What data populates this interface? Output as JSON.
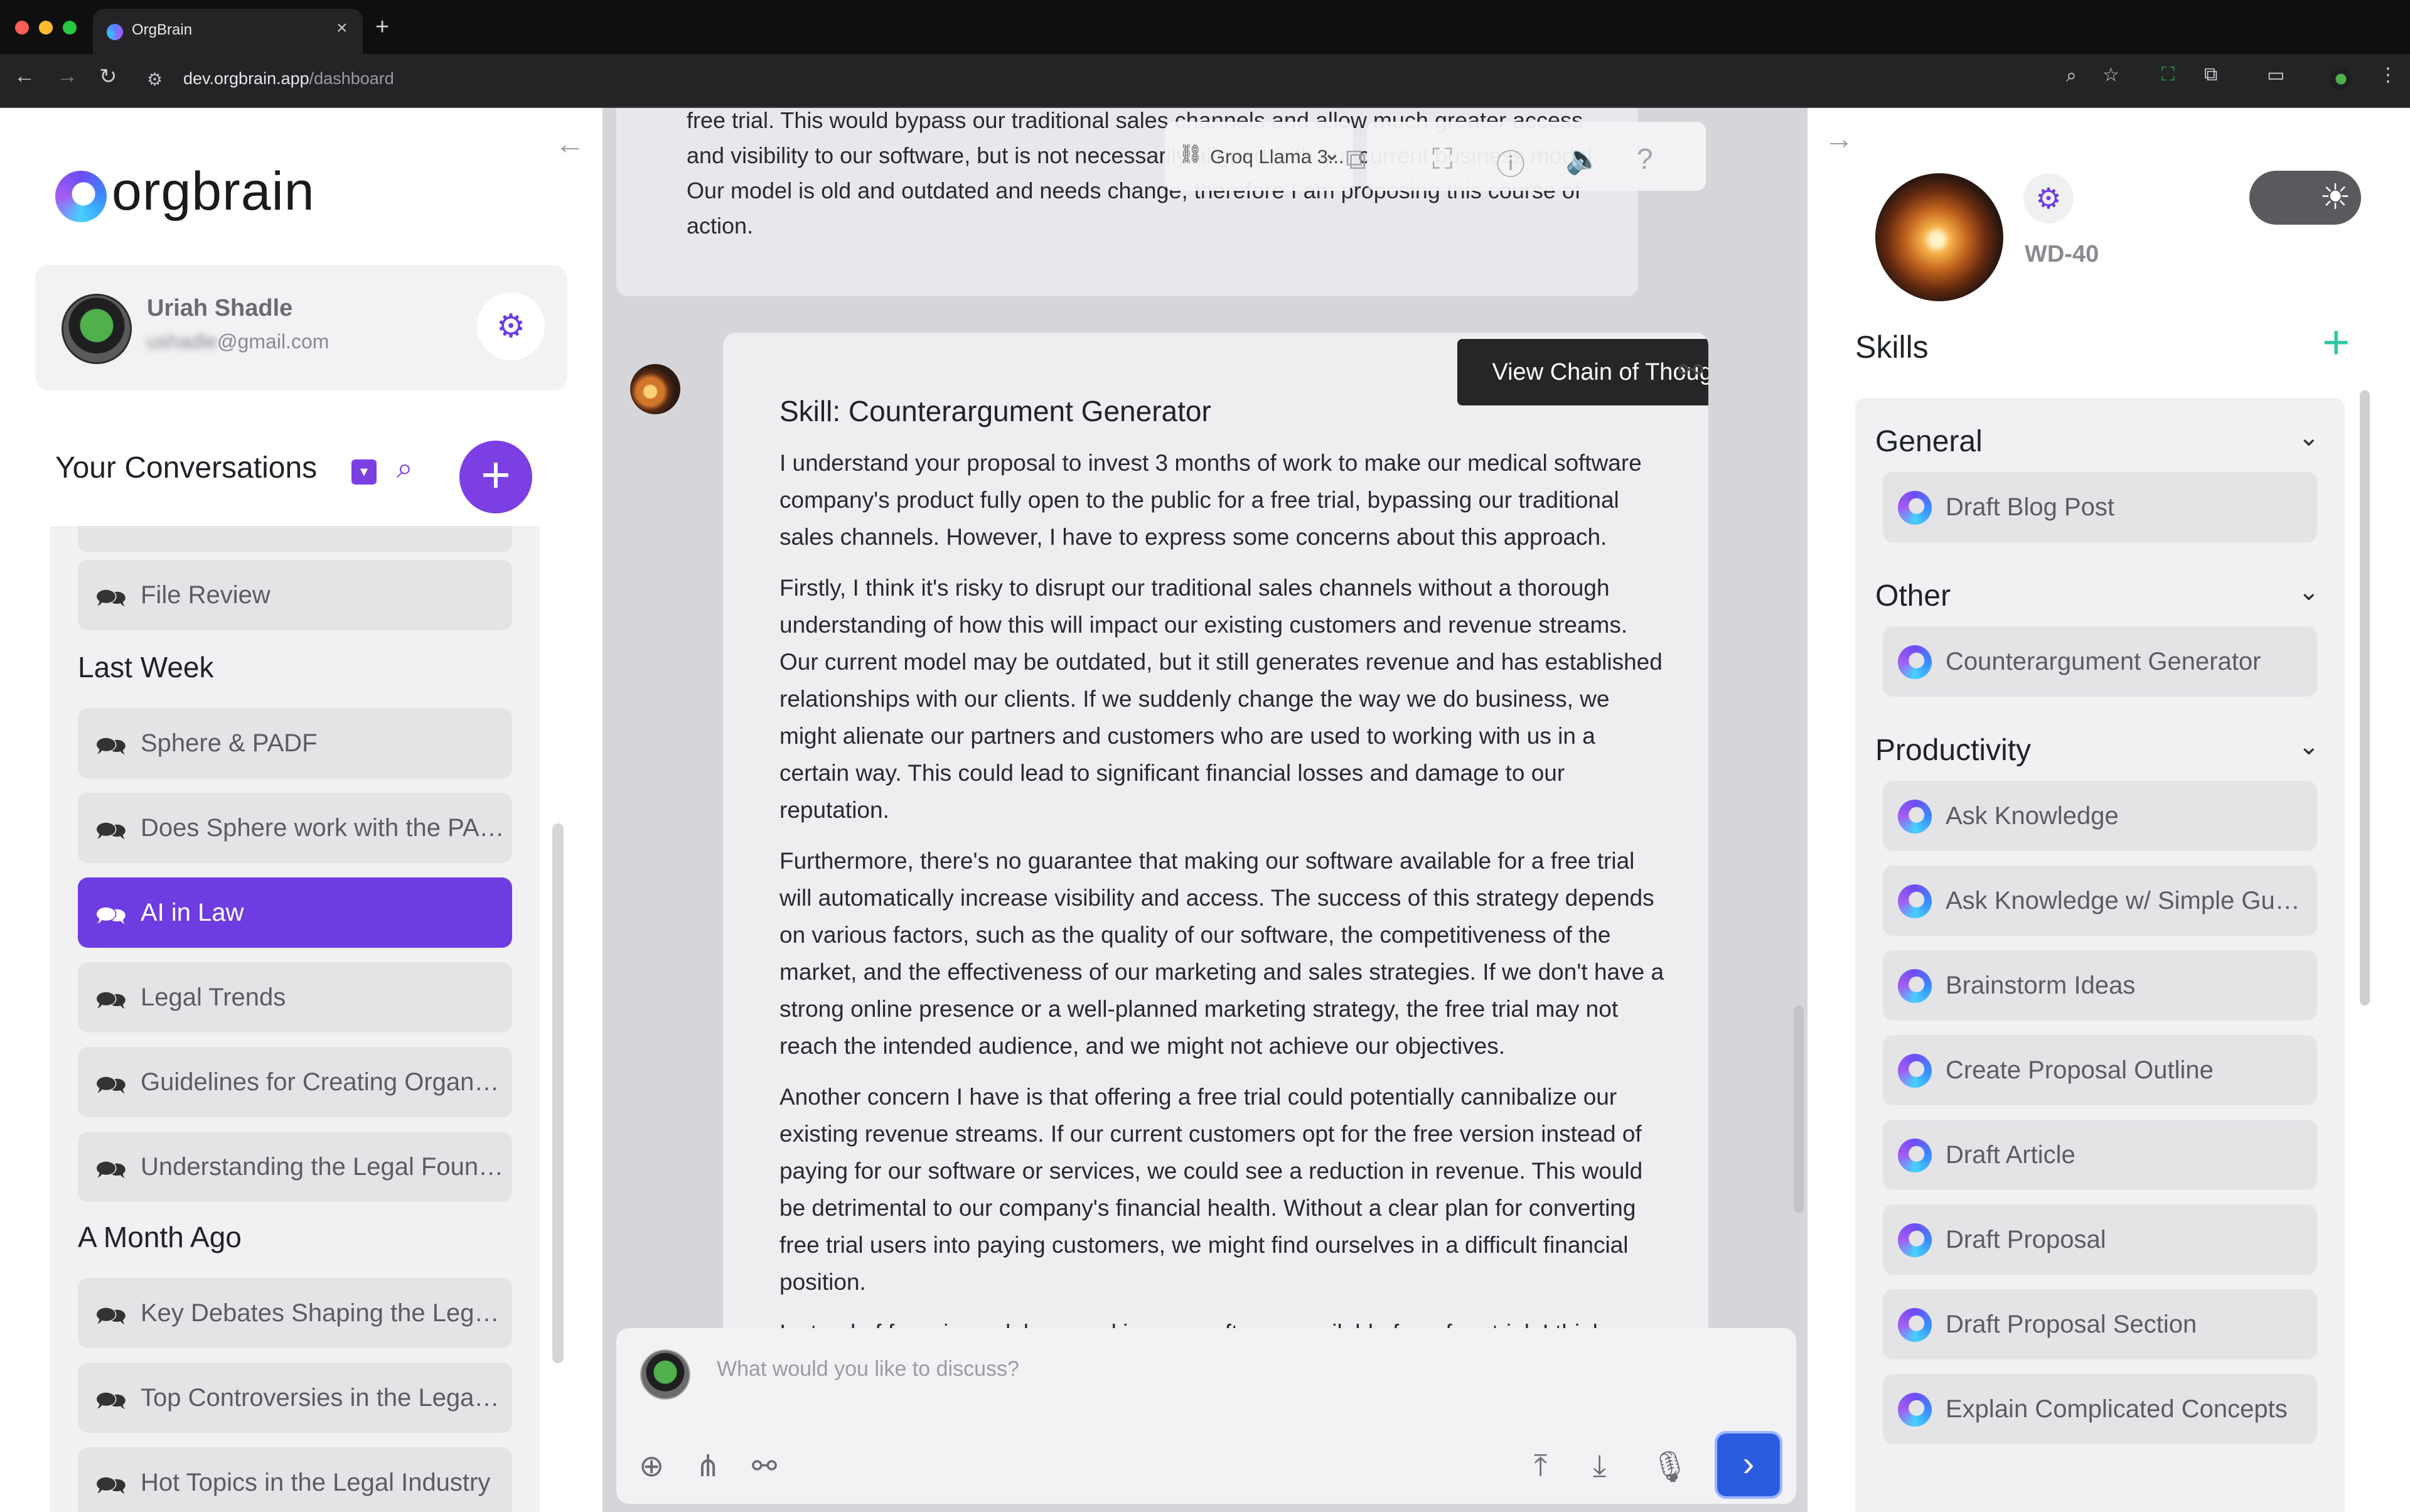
{
  "browser": {
    "tab_title": "OrgBrain",
    "tab_close": "×",
    "new_tab": "+",
    "url_host": "dev.orgbrain.app",
    "url_path": "/dashboard"
  },
  "sidebar": {
    "logo_text": "orgbrain",
    "user": {
      "name": "Uriah Shadle",
      "email_hidden": "ushadle",
      "email_domain": "@gmail.com"
    },
    "conversations_title": "Your Conversations",
    "items_top": [
      {
        "label": "File Review",
        "active": false
      }
    ],
    "groups": [
      {
        "title": "Last Week",
        "items": [
          {
            "label": "Sphere & PADF",
            "active": false
          },
          {
            "label": "Does Sphere work with the PADF?",
            "active": false
          },
          {
            "label": "AI in Law",
            "active": true
          },
          {
            "label": "Legal Trends",
            "active": false
          },
          {
            "label": "Guidelines for Creating Organizational Policies",
            "active": false
          },
          {
            "label": "Understanding the Legal Foundations",
            "active": false
          }
        ]
      },
      {
        "title": "A Month Ago",
        "items": [
          {
            "label": "Key Debates Shaping the Legal Field",
            "active": false
          },
          {
            "label": "Top Controversies in the Legal Industry",
            "active": false
          },
          {
            "label": "Hot Topics in the Legal Industry",
            "active": false
          }
        ]
      }
    ]
  },
  "chat": {
    "model_label": "Groq Llama 3...",
    "previous_message": "free trial. This would bypass our traditional sales channels and allow much greater access and visibility to our software, but is not necessarily aligned with our current business model. Our model is old and outdated and needs change, therefore I am proposing this course of action.",
    "tooltip": "View Chain of Thought",
    "skill_title": "Skill: Counterargument Generator",
    "paragraphs": [
      "I understand your proposal to invest 3 months of work to make our medical software company's product fully open to the public for a free trial, bypassing our traditional sales channels. However, I have to express some concerns about this approach.",
      "Firstly, I think it's risky to disrupt our traditional sales channels without a thorough understanding of how this will impact our existing customers and revenue streams. Our current model may be outdated, but it still generates revenue and has established relationships with our clients. If we suddenly change the way we do business, we might alienate our partners and customers who are used to working with us in a certain way. This could lead to significant financial losses and damage to our reputation.",
      "Furthermore, there's no guarantee that making our software available for a free trial will automatically increase visibility and access. The success of this strategy depends on various factors, such as the quality of our software, the competitiveness of the market, and the effectiveness of our marketing and sales strategies. If we don't have a strong online presence or a well-planned marketing strategy, the free trial may not reach the intended audience, and we might not achieve our objectives.",
      "Another concern I have is that offering a free trial could potentially cannibalize our existing revenue streams. If our current customers opt for the free version instead of paying for our software or services, we could see a reduction in revenue. This would be detrimental to our company's financial health. Without a clear plan for converting free trial users into paying customers, we might find ourselves in a difficult financial position.",
      "Instead of focusing solely on making our software available for a free trial, I think we"
    ],
    "composer_placeholder": "What would you like to discuss?"
  },
  "agent": {
    "name": "WD-40"
  },
  "skills": {
    "title": "Skills",
    "groups": [
      {
        "title": "General",
        "items": [
          "Draft Blog Post"
        ]
      },
      {
        "title": "Other",
        "items": [
          "Counterargument Generator"
        ]
      },
      {
        "title": "Productivity",
        "items": [
          "Ask Knowledge",
          "Ask Knowledge w/ Simple Guardrails",
          "Brainstorm Ideas",
          "Create Proposal Outline",
          "Draft Article",
          "Draft Proposal",
          "Draft Proposal Section",
          "Explain Complicated Concepts"
        ]
      }
    ]
  },
  "colors": {
    "accent": "#6e3ce0",
    "send": "#2b5ce0",
    "add": "#2fc8a0"
  },
  "icons": {
    "conversation": "chat-bubble-icon",
    "archive": "archive-icon",
    "search": "search-icon",
    "settings": "gear-icon",
    "cot": "graph-nodes-icon",
    "send": "chevron-right-icon"
  }
}
